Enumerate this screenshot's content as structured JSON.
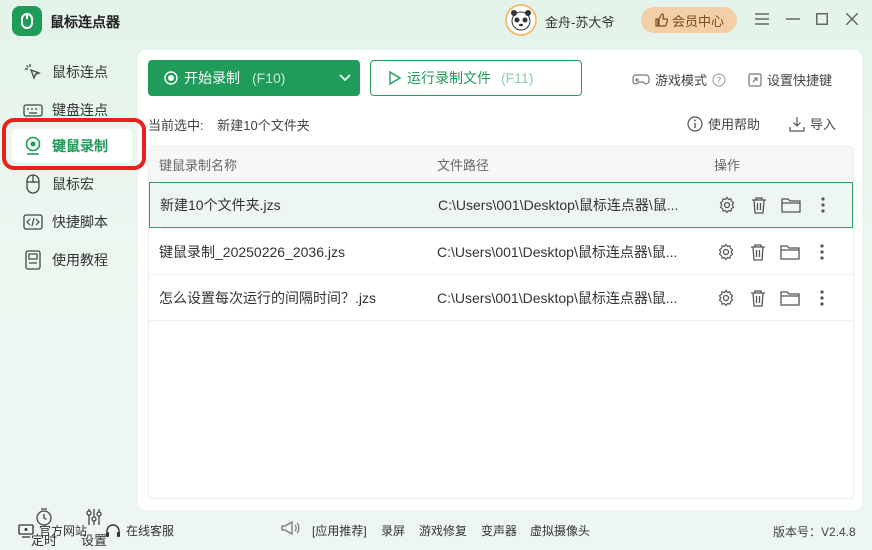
{
  "app": {
    "title": "鼠标连点器",
    "logo_icon": "mouse-icon",
    "accent_color": "#1f9b5a"
  },
  "user": {
    "name": "金舟-苏大爷",
    "vip_label": "会员中心"
  },
  "sidebar": {
    "items": [
      {
        "label": "鼠标连点",
        "icon": "click-icon"
      },
      {
        "label": "键盘连点",
        "icon": "keyboard-icon"
      },
      {
        "label": "键鼠录制",
        "icon": "record-icon",
        "active": true
      },
      {
        "label": "鼠标宏",
        "icon": "mouse-icon"
      },
      {
        "label": "快捷脚本",
        "icon": "code-icon"
      },
      {
        "label": "使用教程",
        "icon": "tutorial-icon"
      }
    ],
    "bottom": {
      "timer_label": "定时",
      "settings_label": "设置"
    }
  },
  "toolbar": {
    "record_label": "开始录制",
    "record_hotkey": "(F10)",
    "run_label": "运行录制文件",
    "run_hotkey": "(F11)",
    "game_mode_label": "游戏模式",
    "shortcut_label": "设置快捷键",
    "help_label": "使用帮助",
    "import_label": "导入"
  },
  "selection": {
    "prefix": "当前选中:",
    "value": "新建10个文件夹"
  },
  "table": {
    "headers": {
      "name": "键鼠录制名称",
      "path": "文件路径",
      "ops": "操作"
    },
    "rows": [
      {
        "name": "新建10个文件夹.jzs",
        "path": "C:\\Users\\001\\Desktop\\鼠标连点器\\鼠...",
        "selected": true
      },
      {
        "name": "键鼠录制_20250226_2036.jzs",
        "path": "C:\\Users\\001\\Desktop\\鼠标连点器\\鼠...",
        "selected": false
      },
      {
        "name": "怎么设置每次运行的间隔时间？.jzs",
        "path": "C:\\Users\\001\\Desktop\\鼠标连点器\\鼠...",
        "selected": false
      }
    ]
  },
  "footer": {
    "website_label": "官方网站",
    "support_label": "在线客服",
    "ad_label": "[应用推荐]",
    "ad_items": [
      "录屏",
      "游戏修复",
      "变声器",
      "虚拟摄像头"
    ],
    "version": "版本号：V2.4.8"
  }
}
